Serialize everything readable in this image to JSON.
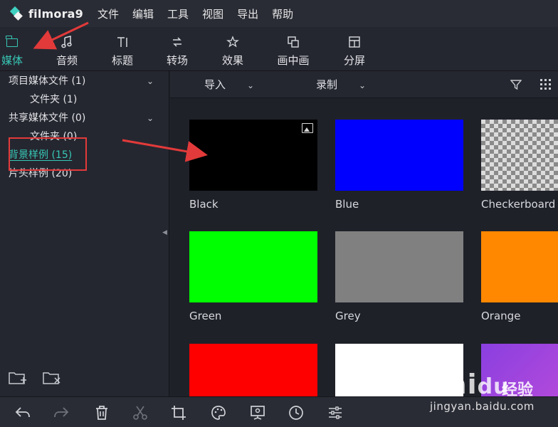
{
  "app": {
    "logo_text": "filmora9",
    "menu": [
      "文件",
      "编辑",
      "工具",
      "视图",
      "导出",
      "帮助"
    ]
  },
  "tabs": [
    {
      "label": "媒体",
      "icon": "folder-icon",
      "active": true
    },
    {
      "label": "音频",
      "icon": "music-note-icon"
    },
    {
      "label": "标题",
      "icon": "text-title-icon"
    },
    {
      "label": "转场",
      "icon": "transition-icon"
    },
    {
      "label": "效果",
      "icon": "effects-icon"
    },
    {
      "label": "画中画",
      "icon": "pip-icon"
    },
    {
      "label": "分屏",
      "icon": "split-screen-icon"
    }
  ],
  "sidebar": {
    "items": [
      {
        "label": "项目媒体文件 (1)",
        "expandable": true
      },
      {
        "label": "文件夹 (1)"
      },
      {
        "label": "共享媒体文件 (0)",
        "expandable": true
      },
      {
        "label": "文件夹 (0)"
      },
      {
        "label": "背景样例 (15)",
        "selected": true
      },
      {
        "label": "片头样例 (20)"
      }
    ],
    "footer_icons": [
      "new-folder-icon",
      "delete-folder-icon"
    ]
  },
  "content_toolbar": {
    "import_label": "导入",
    "record_label": "录制",
    "icons": [
      "filter-icon",
      "grid-view-icon"
    ]
  },
  "tiles": [
    {
      "name": "Black",
      "color": "#000000",
      "badge": "image-icon"
    },
    {
      "name": "Blue",
      "color": "#0000ff"
    },
    {
      "name": "Checkerboard",
      "color": "checker"
    },
    {
      "name": "Green",
      "color": "#00ff00"
    },
    {
      "name": "Grey",
      "color": "#808080"
    },
    {
      "name": "Orange",
      "color": "#ff8800"
    },
    {
      "name": "",
      "color": "#ff0000"
    },
    {
      "name": "",
      "color": "#ffffff"
    },
    {
      "name": "",
      "color": "purple-gradient"
    }
  ],
  "bottom_toolbar": [
    "undo-icon",
    "redo-icon",
    "delete-icon",
    "cut-icon",
    "crop-icon",
    "color-palette-icon",
    "green-screen-icon",
    "speed-icon",
    "audio-mixer-icon"
  ],
  "watermark": {
    "brand": "Bai",
    "brand2": "du",
    "cn": "经验",
    "url": "jingyan.baidu.com"
  }
}
